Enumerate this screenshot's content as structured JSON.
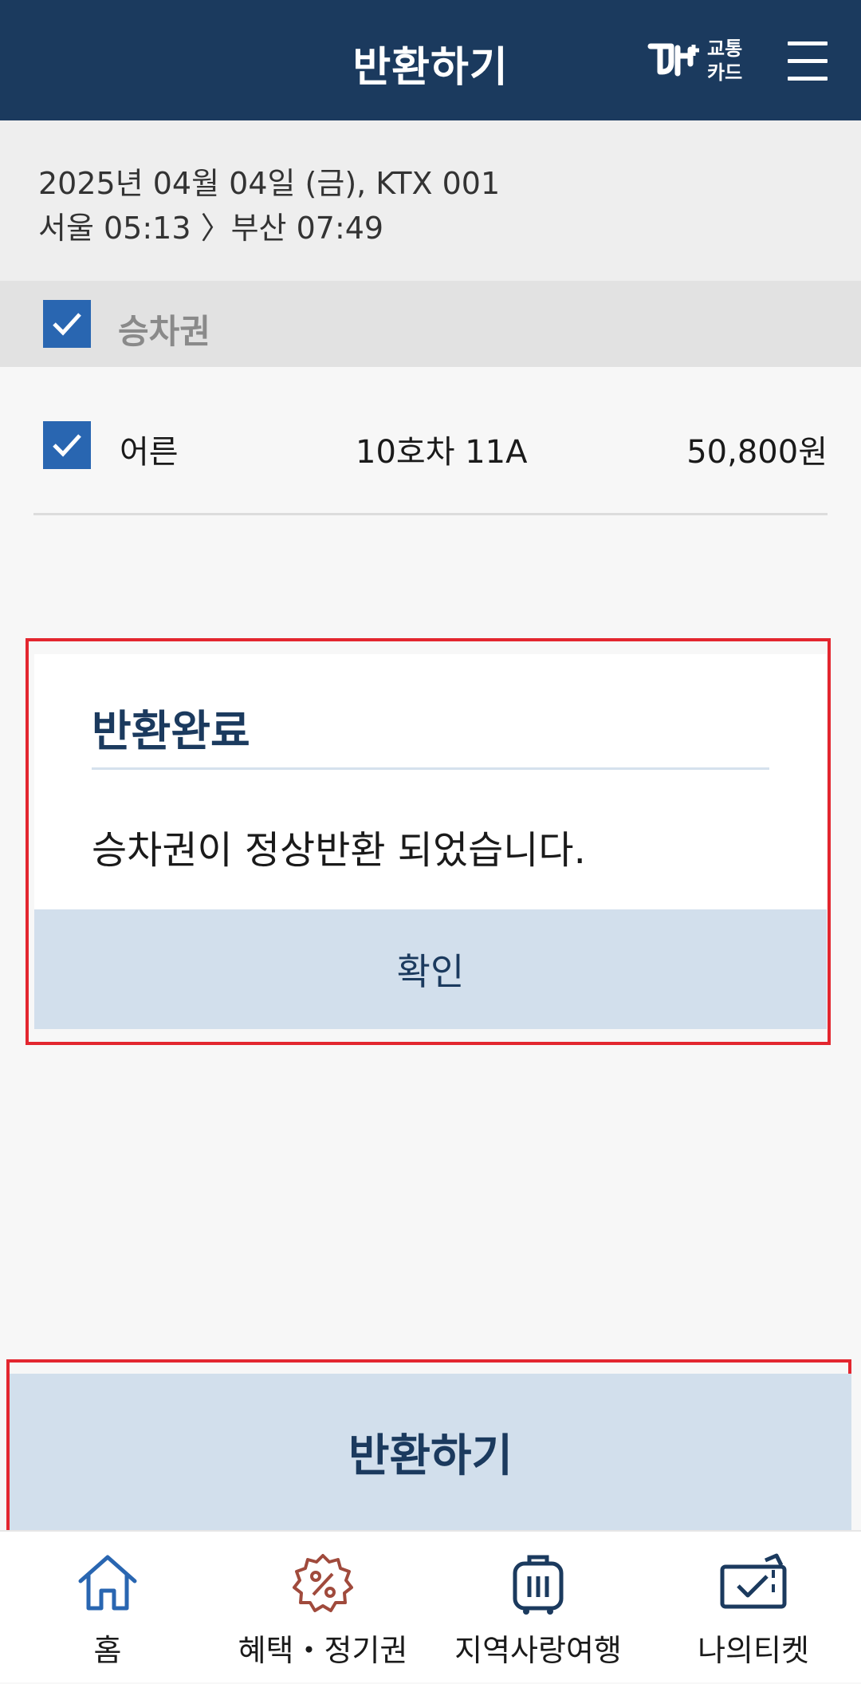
{
  "header": {
    "title": "반환하기",
    "brand_text_line1": "교통",
    "brand_text_line2": "카드"
  },
  "trip": {
    "date_train": "2025년 04월 04일 (금), KTX 001",
    "route": "서울 05:13 〉부산 07:49"
  },
  "section": {
    "label": "승차권"
  },
  "ticket": {
    "type": "어른",
    "seat": "10호차 11A",
    "price": "50,800원"
  },
  "dialog": {
    "title": "반환완료",
    "message": "승차권이 정상반환 되었습니다.",
    "confirm_label": "확인"
  },
  "actions": {
    "return_label": "반환하기"
  },
  "nav": {
    "items": [
      {
        "label": "홈",
        "icon": "home-icon"
      },
      {
        "label": "혜택・정기권",
        "icon": "discount-badge-icon"
      },
      {
        "label": "지역사랑여행",
        "icon": "luggage-icon"
      },
      {
        "label": "나의티켓",
        "icon": "ticket-icon"
      }
    ]
  },
  "colors": {
    "header_bg": "#1b3a5e",
    "checkbox": "#2966b1",
    "button_bg": "#d2dfec",
    "highlight_outline": "#e3262f",
    "discount_icon": "#a04a3c"
  }
}
